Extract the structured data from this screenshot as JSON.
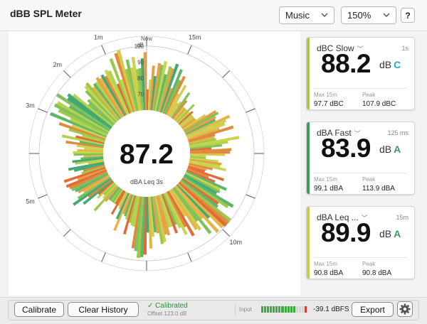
{
  "app": {
    "title": "dBB SPL Meter"
  },
  "toolbar": {
    "mode_select": "Music",
    "zoom_select": "150%",
    "help_label": "?"
  },
  "meter": {
    "center_value": "87.2",
    "center_label": "dBA Leq 3s",
    "scale_unit_top": "Now",
    "scale_unit_db": "dB",
    "scale_ticks": [
      "100",
      "90",
      "80",
      "70"
    ],
    "time_labels": [
      "15m",
      "10m",
      "5m",
      "3m",
      "2m",
      "1m"
    ],
    "scale_min_db": 60,
    "scale_max_db": 100
  },
  "cards": [
    {
      "label": "dBC Slow",
      "window": "1s",
      "value": "88.2",
      "unit": "dB",
      "weighting": "C",
      "accent_color": "#a8c64a",
      "weighting_color": "#2aa7c9",
      "max_label": "Max 15m",
      "max_value": "97.7 dBC",
      "peak_label": "Peak",
      "peak_value": "107.9 dBC"
    },
    {
      "label": "dBA Fast",
      "window": "125 ms",
      "value": "83.9",
      "unit": "dB",
      "weighting": "A",
      "accent_color": "#3a9c5a",
      "weighting_color": "#3a9c5a",
      "max_label": "Max 15m",
      "max_value": "99.1 dBA",
      "peak_label": "Peak",
      "peak_value": "113.9 dBA"
    },
    {
      "label": "dBA Leq ...",
      "window": "15m",
      "value": "89.9",
      "unit": "dB",
      "weighting": "A",
      "accent_color": "#c9cc4a",
      "weighting_color": "#3a9c5a",
      "max_label": "Max 15m",
      "max_value": "90.8 dBA",
      "peak_label": "Peak",
      "peak_value": "90.8 dBA"
    }
  ],
  "footer": {
    "calibrate_label": "Calibrate",
    "clear_history_label": "Clear History",
    "calibrated_status": "✓ Calibrated",
    "offset_text": "Offset 123.0 dB",
    "input_label": "Input",
    "input_level": 0.72,
    "dbfs_value": "-39.1 dBFS",
    "export_label": "Export"
  }
}
